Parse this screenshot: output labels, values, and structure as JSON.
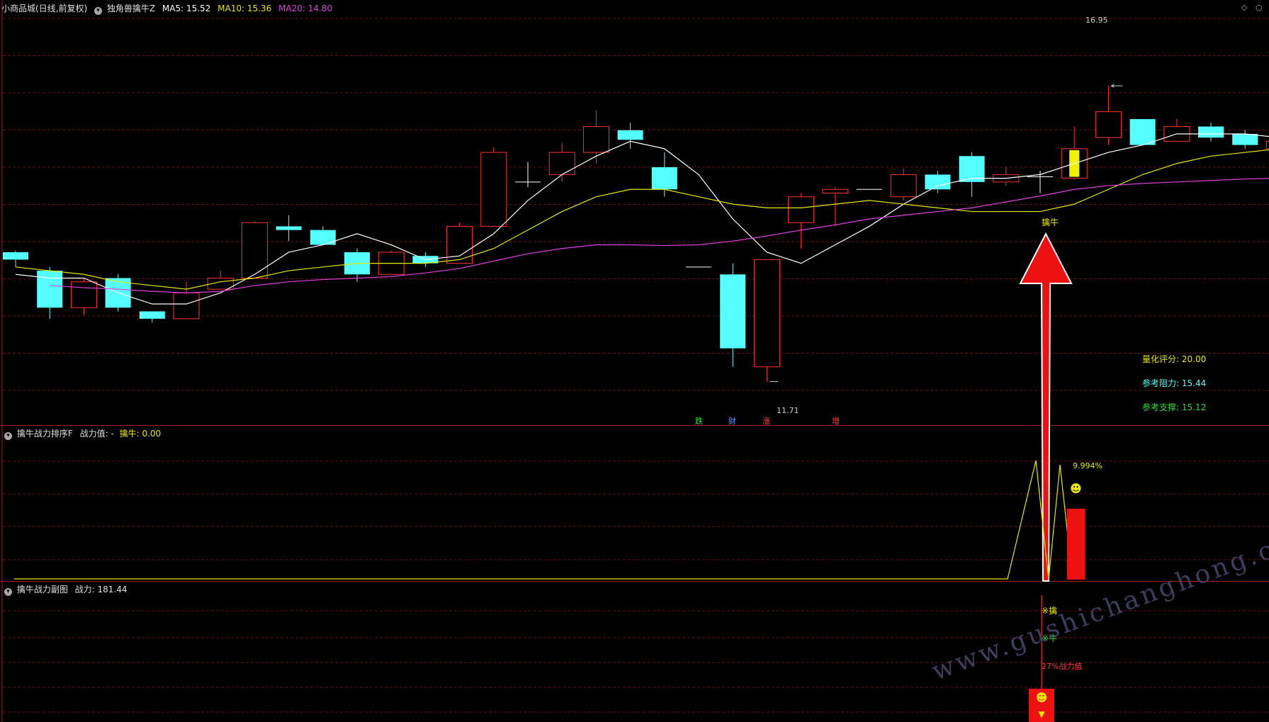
{
  "main_header": {
    "title": "小商品城(日线,前复权)",
    "indicator": "独角兽擒牛Z",
    "ma5": "MA5: 15.52",
    "ma10": "MA10: 15.36",
    "ma20": "MA20: 14.80"
  },
  "sub1_header": {
    "title": "擒牛战力排序F",
    "label": "战力值:",
    "value_dash": "-",
    "qinniu": "擒牛: 0.00"
  },
  "sub2_header": {
    "title": "擒牛战力副图",
    "value": "战力: 181.44"
  },
  "right_info": {
    "score": "量化评分: 20.00",
    "resistance": "参考阻力: 15.44",
    "support": "参考支撑: 15.12"
  },
  "annotations": {
    "high_price": "16.95",
    "low_price": "11.71",
    "qinniu_label": "擒牛",
    "pct": "9.994%",
    "tag_die": "跌",
    "tag_cai": "财",
    "tag_zhang": "涨",
    "tag_zeng": "增",
    "sub2_qin": "※擒",
    "sub2_niu": "※牛",
    "sub2_zhanli": "27%战力值",
    "smiley": "☻"
  },
  "watermark": "www.gushichanghong.com",
  "colors": {
    "background": "#000000",
    "separator": "#b01c1c",
    "up": "#ff3232",
    "down": "#54ffff",
    "ma5": "#ffffff",
    "ma10": "#e8e800",
    "ma20": "#e040e0",
    "grid": "#6a1010"
  },
  "chart_data": {
    "type": "candlestick",
    "title": "小商品城(日线,前复权)",
    "candles": [
      {
        "o": 14.7,
        "c": 14.6,
        "h": 14.72,
        "l": 14.5
      },
      {
        "o": 14.45,
        "c": 13.95,
        "h": 14.5,
        "l": 13.8
      },
      {
        "o": 13.95,
        "c": 14.3,
        "h": 14.35,
        "l": 13.85
      },
      {
        "o": 14.35,
        "c": 13.95,
        "h": 14.4,
        "l": 13.9
      },
      {
        "o": 13.9,
        "c": 13.8,
        "h": 13.9,
        "l": 13.75
      },
      {
        "o": 13.8,
        "c": 14.15,
        "h": 14.3,
        "l": 13.8
      },
      {
        "o": 14.2,
        "c": 14.35,
        "h": 14.45,
        "l": 14.2
      },
      {
        "o": 14.35,
        "c": 15.1,
        "h": 15.12,
        "l": 14.35
      },
      {
        "o": 15.05,
        "c": 15.0,
        "h": 15.2,
        "l": 14.85
      },
      {
        "o": 15.0,
        "c": 14.8,
        "h": 15.05,
        "l": 14.8
      },
      {
        "o": 14.7,
        "c": 14.4,
        "h": 14.75,
        "l": 14.3
      },
      {
        "o": 14.4,
        "c": 14.7,
        "h": 14.72,
        "l": 14.4
      },
      {
        "o": 14.65,
        "c": 14.55,
        "h": 14.7,
        "l": 14.5
      },
      {
        "o": 14.55,
        "c": 15.05,
        "h": 15.1,
        "l": 14.55
      },
      {
        "o": 15.05,
        "c": 16.05,
        "h": 16.12,
        "l": 15.05
      },
      {
        "o": 15.65,
        "c": 15.65,
        "h": 15.92,
        "l": 15.58
      },
      {
        "o": 15.75,
        "c": 16.05,
        "h": 16.18,
        "l": 15.65
      },
      {
        "o": 16.05,
        "c": 16.4,
        "h": 16.62,
        "l": 15.9
      },
      {
        "o": 16.35,
        "c": 16.22,
        "h": 16.45,
        "l": 16.1
      },
      {
        "o": 15.85,
        "c": 15.55,
        "h": 16.05,
        "l": 15.45
      },
      {
        "o": 14.5,
        "c": 14.5,
        "h": 14.5,
        "l": 14.5
      },
      {
        "o": 14.4,
        "c": 13.4,
        "h": 14.55,
        "l": 13.15
      },
      {
        "o": 13.15,
        "c": 14.6,
        "h": 14.6,
        "l": 12.95
      },
      {
        "o": 15.1,
        "c": 15.45,
        "h": 15.5,
        "l": 14.75
      },
      {
        "o": 15.5,
        "c": 15.55,
        "h": 15.58,
        "l": 15.05
      },
      {
        "o": 15.55,
        "c": 15.55,
        "h": 15.55,
        "l": 15.55
      },
      {
        "o": 15.45,
        "c": 15.75,
        "h": 15.83,
        "l": 15.4
      },
      {
        "o": 15.75,
        "c": 15.55,
        "h": 15.8,
        "l": 15.5
      },
      {
        "o": 16.0,
        "c": 15.65,
        "h": 16.05,
        "l": 15.45
      },
      {
        "o": 15.65,
        "c": 15.75,
        "h": 15.85,
        "l": 15.6
      },
      {
        "o": 15.72,
        "c": 15.72,
        "h": 15.8,
        "l": 15.5
      },
      {
        "o": 15.7,
        "c": 16.1,
        "h": 16.4,
        "l": 15.68
      },
      {
        "o": 16.25,
        "c": 16.6,
        "h": 16.95,
        "l": 16.15
      },
      {
        "o": 16.5,
        "c": 16.15,
        "h": 16.5,
        "l": 16.15
      },
      {
        "o": 16.2,
        "c": 16.4,
        "h": 16.5,
        "l": 16.2
      },
      {
        "o": 16.4,
        "c": 16.25,
        "h": 16.45,
        "l": 16.2
      },
      {
        "o": 16.3,
        "c": 16.15,
        "h": 16.35,
        "l": 16.1
      },
      {
        "o": 16.1,
        "c": 16.2,
        "h": 16.25,
        "l": 15.95
      }
    ],
    "ma5": [
      14.4,
      14.35,
      14.35,
      14.15,
      14.0,
      14.0,
      14.15,
      14.4,
      14.7,
      14.8,
      14.95,
      14.8,
      14.6,
      14.65,
      14.95,
      15.4,
      15.75,
      16.0,
      16.2,
      16.1,
      15.75,
      15.15,
      14.7,
      14.55,
      14.8,
      15.05,
      15.35,
      15.6,
      15.7,
      15.7,
      15.75,
      15.9,
      16.05,
      16.15,
      16.3,
      16.3,
      16.3,
      16.25
    ],
    "ma10": [
      14.5,
      14.45,
      14.4,
      14.3,
      14.25,
      14.2,
      14.3,
      14.35,
      14.45,
      14.5,
      14.55,
      14.55,
      14.55,
      14.6,
      14.75,
      15.0,
      15.25,
      15.45,
      15.55,
      15.55,
      15.45,
      15.35,
      15.3,
      15.3,
      15.35,
      15.4,
      15.35,
      15.3,
      15.25,
      15.25,
      15.25,
      15.35,
      15.55,
      15.75,
      15.9,
      16.0,
      16.05,
      16.1
    ],
    "ma20_start_index": 1,
    "ma20": [
      14.25,
      14.22,
      14.2,
      14.17,
      14.15,
      14.17,
      14.25,
      14.3,
      14.33,
      14.35,
      14.37,
      14.42,
      14.48,
      14.58,
      14.68,
      14.75,
      14.8,
      14.8,
      14.79,
      14.8,
      14.85,
      14.92,
      15.0,
      15.07,
      15.15,
      15.2,
      15.25,
      15.3,
      15.38,
      15.46,
      15.55,
      15.6,
      15.63,
      15.65,
      15.67,
      15.69,
      15.7
    ],
    "ylim": [
      12.4,
      17.9
    ],
    "high_marker": "16.95",
    "low_marker": "11.71",
    "sub1": {
      "type": "line",
      "values_flat": 0,
      "spike_value": "9.994%",
      "bar": "up"
    },
    "sub2": {
      "value": "181.44"
    }
  }
}
